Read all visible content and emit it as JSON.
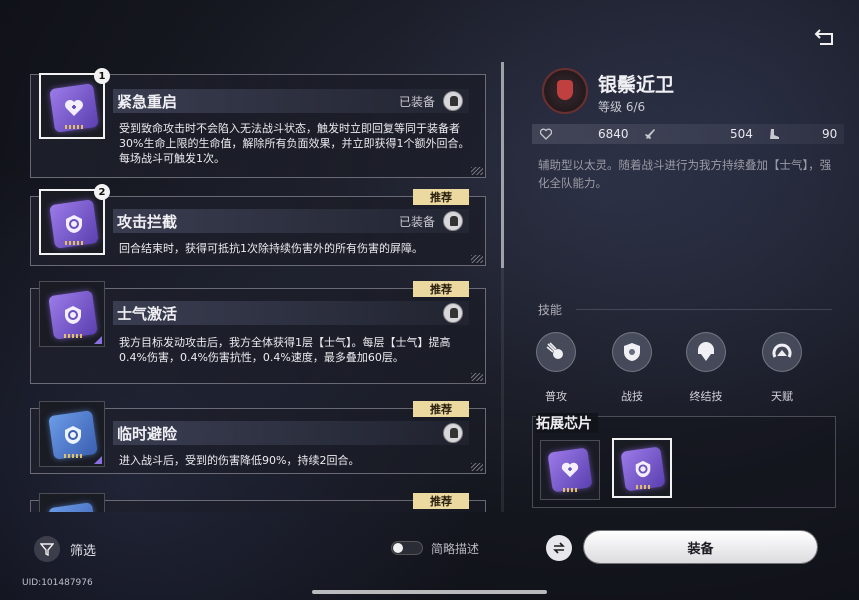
{
  "chips": [
    {
      "name": "紧急重启",
      "number": "1",
      "status": "已装备",
      "tag": "",
      "description": "受到致命攻击时不会陷入无法战斗状态，触发时立即回复等同于装备者30%生命上限的生命值，解除所有负面效果，并立即获得1个额外回合。每场战斗可触发1次。",
      "icon": "heart-chip-icon"
    },
    {
      "name": "攻击拦截",
      "number": "2",
      "status": "已装备",
      "tag": "推荐",
      "description": "回合结束时，获得可抵抗1次除持续伤害外的所有伤害的屏障。",
      "icon": "shield-chip-icon"
    },
    {
      "name": "士气激活",
      "number": "",
      "status": "",
      "tag": "推荐",
      "description": "我方目标发动攻击后，我方全体获得1层【士气】。每层【士气】提高0.4%伤害，0.4%伤害抗性，0.4%速度，最多叠加60层。",
      "icon": "shield-chip-icon"
    },
    {
      "name": "临时避险",
      "number": "",
      "status": "",
      "tag": "推荐",
      "description": "进入战斗后，受到的伤害降低90%，持续2回合。",
      "icon": "shield-chip-icon"
    },
    {
      "name": "",
      "number": "",
      "status": "",
      "tag": "推荐",
      "description": "",
      "icon": "shield-chip-icon"
    }
  ],
  "filter_label": "筛选",
  "brief_desc_label": "简略描述",
  "uid": "UID:101487976",
  "character": {
    "name": "银鬃近卫",
    "level": "等级 6/6",
    "hp": "6840",
    "attack": "504",
    "speed": "90",
    "description": "辅助型以太灵。随着战斗进行为我方持续叠加【士气】，强化全队能力。"
  },
  "skills_label": "技能",
  "skills": [
    "普攻",
    "战技",
    "终结技",
    "天赋"
  ],
  "extension_title": "拓展芯片",
  "equip_label": "装备"
}
